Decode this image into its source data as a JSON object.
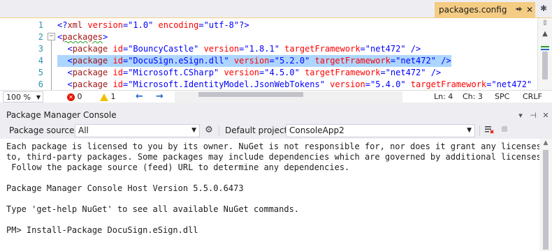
{
  "editor_tab": {
    "title": "packages.config",
    "pin_icon": "pin-icon",
    "close_icon": "close-icon"
  },
  "editor": {
    "line_numbers": [
      "1",
      "2",
      "3",
      "4",
      "5",
      "6"
    ],
    "lines": [
      {
        "parts": [
          {
            "t": "br",
            "s": "<?"
          },
          {
            "t": "tag",
            "s": "xml"
          },
          {
            "t": "attr",
            "s": " version"
          },
          {
            "t": "br",
            "s": "="
          },
          {
            "t": "val",
            "s": "\"1.0\""
          },
          {
            "t": "attr",
            "s": " encoding"
          },
          {
            "t": "br",
            "s": "="
          },
          {
            "t": "val",
            "s": "\"utf-8\""
          },
          {
            "t": "br",
            "s": "?>"
          }
        ]
      },
      {
        "parts": [
          {
            "t": "br",
            "s": "<"
          },
          {
            "t": "tag",
            "s": "packages"
          },
          {
            "t": "br",
            "s": ">"
          }
        ]
      },
      {
        "parts": [
          {
            "t": "br",
            "s": "  <"
          },
          {
            "t": "tag",
            "s": "package"
          },
          {
            "t": "attr",
            "s": " id"
          },
          {
            "t": "br",
            "s": "="
          },
          {
            "t": "val",
            "s": "\"BouncyCastle\""
          },
          {
            "t": "attr",
            "s": " version"
          },
          {
            "t": "br",
            "s": "="
          },
          {
            "t": "val",
            "s": "\"1.8.1\""
          },
          {
            "t": "attr",
            "s": " targetFramework"
          },
          {
            "t": "br",
            "s": "="
          },
          {
            "t": "val",
            "s": "\"net472\""
          },
          {
            "t": "br",
            "s": " />"
          }
        ]
      },
      {
        "parts": [
          {
            "t": "br",
            "s": "  <"
          },
          {
            "t": "tag",
            "s": "package"
          },
          {
            "t": "attr",
            "s": " id"
          },
          {
            "t": "br",
            "s": "="
          },
          {
            "t": "val",
            "s": "\"DocuSign.eSign.dll\""
          },
          {
            "t": "attr",
            "s": " version"
          },
          {
            "t": "br",
            "s": "="
          },
          {
            "t": "val",
            "s": "\"5.2.0\""
          },
          {
            "t": "attr",
            "s": " targetFramework"
          },
          {
            "t": "br",
            "s": "="
          },
          {
            "t": "val",
            "s": "\"net472\""
          },
          {
            "t": "br",
            "s": " />"
          }
        ],
        "selected": true
      },
      {
        "parts": [
          {
            "t": "br",
            "s": "  <"
          },
          {
            "t": "tag",
            "s": "package"
          },
          {
            "t": "attr",
            "s": " id"
          },
          {
            "t": "br",
            "s": "="
          },
          {
            "t": "val",
            "s": "\"Microsoft.CSharp\""
          },
          {
            "t": "attr",
            "s": " version"
          },
          {
            "t": "br",
            "s": "="
          },
          {
            "t": "val",
            "s": "\"4.5.0\""
          },
          {
            "t": "attr",
            "s": " targetFramework"
          },
          {
            "t": "br",
            "s": "="
          },
          {
            "t": "val",
            "s": "\"net472\""
          },
          {
            "t": "br",
            "s": " />"
          }
        ]
      },
      {
        "parts": [
          {
            "t": "br",
            "s": "  <"
          },
          {
            "t": "tag",
            "s": "package"
          },
          {
            "t": "attr",
            "s": " id"
          },
          {
            "t": "br",
            "s": "="
          },
          {
            "t": "val",
            "s": "\"Microsoft.IdentityModel.JsonWebTokens\""
          },
          {
            "t": "attr",
            "s": " version"
          },
          {
            "t": "br",
            "s": "="
          },
          {
            "t": "val",
            "s": "\"5.4.0\""
          },
          {
            "t": "attr",
            "s": " targetFramework"
          },
          {
            "t": "br",
            "s": "="
          },
          {
            "t": "val",
            "s": "\"net472\""
          },
          {
            "t": "br",
            "s": " />"
          }
        ]
      }
    ]
  },
  "status_bar": {
    "zoom": "100 %",
    "errors": "0",
    "warnings": "1",
    "line": "Ln: 4",
    "col": "Ch: 3",
    "mode": "SPC",
    "eol": "CRLF"
  },
  "pmc": {
    "title": "Package Manager Console",
    "package_source_label": "Package source:",
    "package_source_value": "All",
    "default_project_label": "Default project:",
    "default_project_value": "ConsoleApp2",
    "output": [
      "Each package is licensed to you by its owner. NuGet is not responsible for, nor does it grant any licenses",
      "to, third-party packages. Some packages may include dependencies which are governed by additional licenses.",
      " Follow the package source (feed) URL to determine any dependencies.",
      "",
      "Package Manager Console Host Version 5.5.0.6473",
      "",
      "Type 'get-help NuGet' to see all available NuGet commands.",
      "",
      "PM> Install-Package DocuSign.eSign.dll"
    ]
  },
  "colors": {
    "accent_tab": "#f5cc84",
    "selection": "#add6ff",
    "error": "#e51400",
    "warning": "#f0c000"
  }
}
